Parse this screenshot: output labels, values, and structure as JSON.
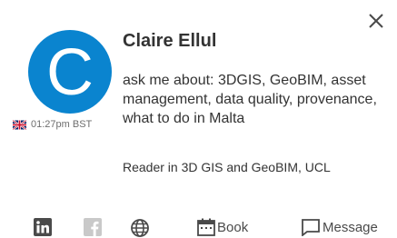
{
  "profile": {
    "avatar_initial": "C",
    "name": "Claire Ellul",
    "bio": "ask me about: 3DGIS, GeoBIM, asset management, data quality, provenance, what to do in Malta",
    "title": "Reader in 3D GIS and GeoBIM, UCL",
    "local_time": "01:27pm BST",
    "flag": "uk-flag-icon"
  },
  "actions": {
    "linkedin_icon": "linkedin-icon",
    "facebook_icon": "facebook-icon",
    "website_icon": "globe-icon",
    "book_label": "Book",
    "message_label": "Message"
  },
  "colors": {
    "avatar_bg": "#0a84cf",
    "text": "#333333",
    "muted": "#6e6e6e",
    "icon": "#4a4a4a",
    "facebook_icon": "#c9c9c9"
  }
}
